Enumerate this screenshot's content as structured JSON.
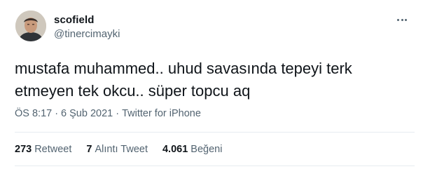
{
  "user": {
    "display_name": "scofield",
    "username": "@tinercimayki",
    "avatar_icon": "profile-photo"
  },
  "menu_icon": "more-dots-icon",
  "tweet": {
    "line1": "mustafa muhammed.. uhud savasında tepeyi terk",
    "line2": "etmeyen tek okcu.. süper topcu aq"
  },
  "meta": {
    "time": "ÖS 8:17",
    "separator": "·",
    "date": "6 Şub 2021",
    "source": "Twitter for iPhone"
  },
  "stats": {
    "retweets_count": "273",
    "retweets_label": "Retweet",
    "quotes_count": "7",
    "quotes_label": "Alıntı Tweet",
    "likes_count": "4.061",
    "likes_label": "Beğeni"
  },
  "colors": {
    "text": "#0f1419",
    "secondary": "#536471",
    "divider": "#e6ecf0"
  }
}
